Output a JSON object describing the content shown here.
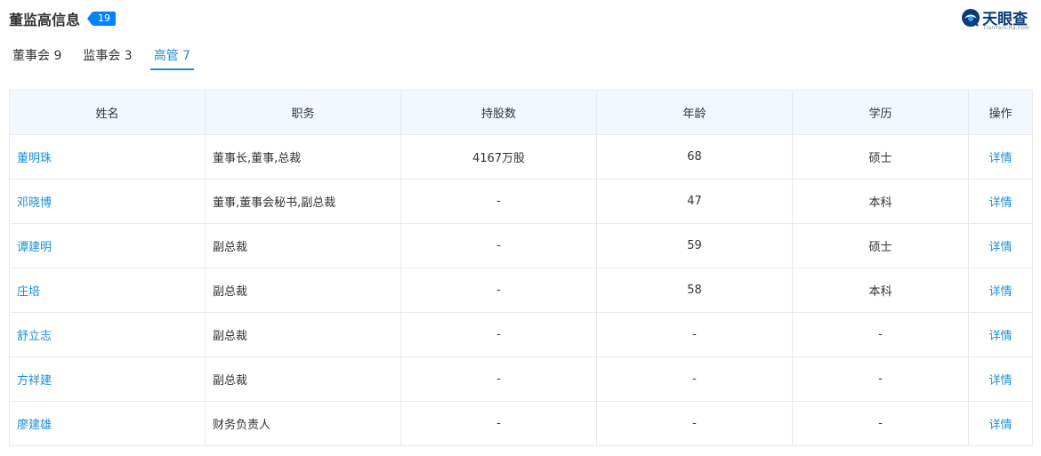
{
  "header": {
    "title": "董监高信息",
    "count": "19"
  },
  "logo": {
    "text": "天眼查",
    "sub": "TianYanCha.com"
  },
  "tabs": [
    {
      "label": "董事会 9",
      "active": false
    },
    {
      "label": "监事会 3",
      "active": false
    },
    {
      "label": "高管 7",
      "active": true
    }
  ],
  "table": {
    "columns": [
      "姓名",
      "职务",
      "持股数",
      "年龄",
      "学历",
      "操作"
    ],
    "rows": [
      {
        "name": "董明珠",
        "position": "董事长,董事,总裁",
        "shares": "4167万股",
        "age": "68",
        "education": "硕士",
        "action": "详情"
      },
      {
        "name": "邓晓博",
        "position": "董事,董事会秘书,副总裁",
        "shares": "-",
        "age": "47",
        "education": "本科",
        "action": "详情"
      },
      {
        "name": "谭建明",
        "position": "副总裁",
        "shares": "-",
        "age": "59",
        "education": "硕士",
        "action": "详情"
      },
      {
        "name": "庄培",
        "position": "副总裁",
        "shares": "-",
        "age": "58",
        "education": "本科",
        "action": "详情"
      },
      {
        "name": "舒立志",
        "position": "副总裁",
        "shares": "-",
        "age": "-",
        "education": "-",
        "action": "详情"
      },
      {
        "name": "方祥建",
        "position": "副总裁",
        "shares": "-",
        "age": "-",
        "education": "-",
        "action": "详情"
      },
      {
        "name": "廖建雄",
        "position": "财务负责人",
        "shares": "-",
        "age": "-",
        "education": "-",
        "action": "详情"
      }
    ]
  },
  "colors": {
    "accent": "#1b8fd6",
    "badge": "#0084ff",
    "header_bg": "#f2f8fe",
    "border": "#e6ebf0"
  }
}
